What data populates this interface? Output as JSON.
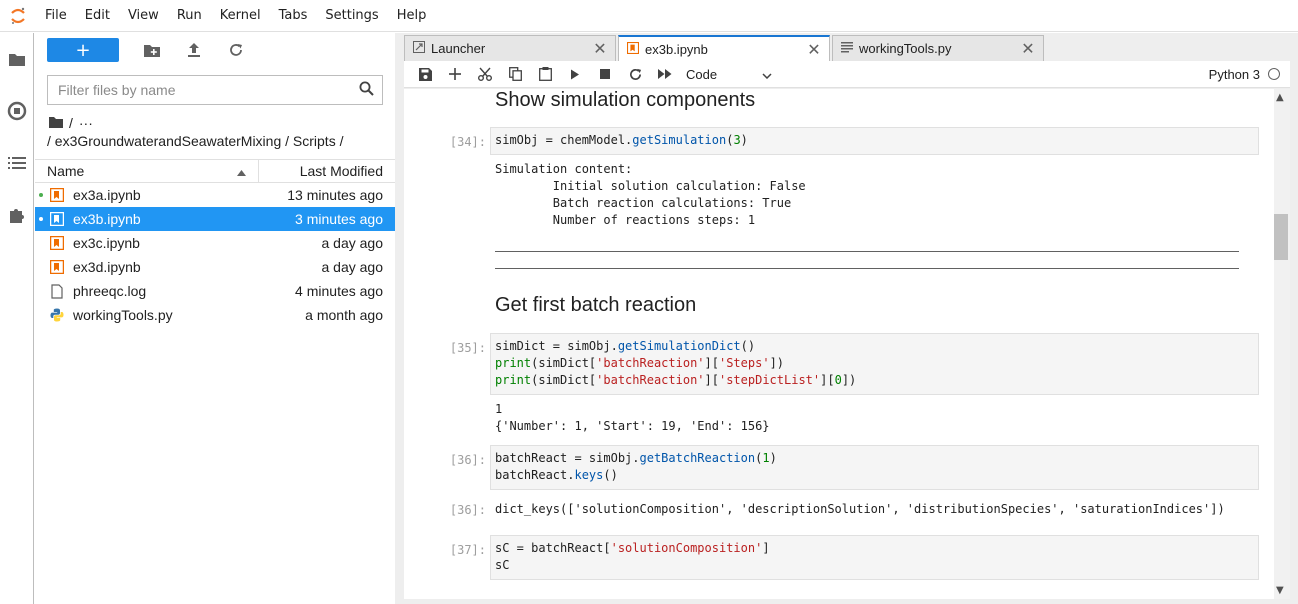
{
  "menu": [
    "File",
    "Edit",
    "View",
    "Run",
    "Kernel",
    "Tabs",
    "Settings",
    "Help"
  ],
  "sidebar_icons": [
    "folder-icon",
    "running-icon",
    "toc-icon",
    "extension-icon"
  ],
  "file_browser": {
    "new_label": "+",
    "filter_placeholder": "Filter files by name",
    "crumb_root": "/",
    "crumb_ellipsis": "···",
    "path": "/ ex3GroundwaterandSeawaterMixing / Scripts /",
    "col_name": "Name",
    "col_modified": "Last Modified",
    "files": [
      {
        "name": "ex3a.ipynb",
        "modified": "13 minutes ago",
        "type": "notebook",
        "running": true,
        "selected": false
      },
      {
        "name": "ex3b.ipynb",
        "modified": "3 minutes ago",
        "type": "notebook",
        "running": true,
        "selected": true
      },
      {
        "name": "ex3c.ipynb",
        "modified": "a day ago",
        "type": "notebook",
        "running": false,
        "selected": false
      },
      {
        "name": "ex3d.ipynb",
        "modified": "a day ago",
        "type": "notebook",
        "running": false,
        "selected": false
      },
      {
        "name": "phreeqc.log",
        "modified": "4 minutes ago",
        "type": "file",
        "running": false,
        "selected": false
      },
      {
        "name": "workingTools.py",
        "modified": "a month ago",
        "type": "python",
        "running": false,
        "selected": false
      }
    ]
  },
  "tabs": [
    {
      "label": "Launcher",
      "active": false
    },
    {
      "label": "ex3b.ipynb",
      "active": true
    },
    {
      "label": "workingTools.py",
      "active": false
    }
  ],
  "nb_toolbar": {
    "cell_type": "Code",
    "kernel": "Python 3"
  },
  "notebook": {
    "h1": "Show simulation components",
    "p34": "[34]:",
    "out34": "Simulation content:\n        Initial solution calculation: False\n        Batch reaction calculations: True\n        Number of reactions steps: 1",
    "h2": "Get first batch reaction",
    "p35": "[35]:",
    "out35": "1\n{'Number': 1, 'Start': 19, 'End': 156}",
    "p36": "[36]:",
    "p36o": "[36]:",
    "out36": "dict_keys(['solutionComposition', 'descriptionSolution', 'distributionSpecies', 'saturationIndices'])",
    "p37": "[37]:"
  }
}
